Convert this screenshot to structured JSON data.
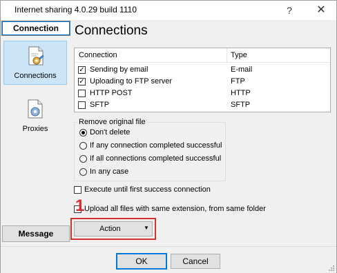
{
  "window": {
    "title": "Internet sharing 4.0.29 build 1110",
    "help_glyph": "?",
    "close_glyph": "✕"
  },
  "nav": {
    "header_label": "Connection",
    "items": [
      {
        "label": "Connections",
        "icon": "document-gear-icon",
        "active": true
      },
      {
        "label": "Proxies",
        "icon": "document-gear-icon",
        "active": false
      }
    ],
    "footer_label": "Message"
  },
  "panel": {
    "title": "Connections",
    "grid": {
      "columns": [
        "Connection",
        "Type"
      ],
      "rows": [
        {
          "name": "Sending by email",
          "type": "E-mail",
          "checked": true
        },
        {
          "name": "Uploading to FTP server",
          "type": "FTP",
          "checked": true
        },
        {
          "name": "HTTP POST",
          "type": "HTTP",
          "checked": false
        },
        {
          "name": "SFTP",
          "type": "SFTP",
          "checked": false
        }
      ]
    },
    "remove_group": {
      "legend": "Remove original file",
      "options": [
        {
          "label": "Don't delete",
          "selected": true
        },
        {
          "label": "If any connection completed successful",
          "selected": false
        },
        {
          "label": "If all connections completed successful",
          "selected": false
        },
        {
          "label": "In any case",
          "selected": false
        }
      ]
    },
    "options": [
      {
        "label": "Execute until first success connection",
        "checked": false
      },
      {
        "label": "Upload all files with same extension, from same folder",
        "checked": false
      }
    ],
    "annotation_number": "1",
    "action_button_label": "Action"
  },
  "footer": {
    "ok_label": "OK",
    "cancel_label": "Cancel"
  },
  "colors": {
    "accent": "#0078d7",
    "highlight": "#d32f2f",
    "selected_nav": "#cce4f7"
  }
}
